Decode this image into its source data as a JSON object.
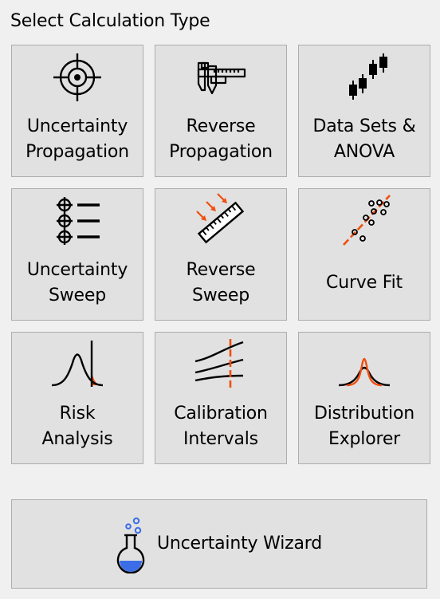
{
  "heading": "Select Calculation Type",
  "colors": {
    "accent": "#f04e0f",
    "flask_liquid": "#3b6ee6",
    "tile_bg": "#e1e1e1",
    "tile_border": "#adadad"
  },
  "tiles": [
    {
      "label": "Uncertainty\nPropagation",
      "icon": "crosshair-icon"
    },
    {
      "label": "Reverse\nPropagation",
      "icon": "caliper-icon"
    },
    {
      "label": "Data Sets &\nANOVA",
      "icon": "candlestick-icon"
    },
    {
      "label": "Uncertainty\nSweep",
      "icon": "sweep-list-icon"
    },
    {
      "label": "Reverse\nSweep",
      "icon": "ruler-icon"
    },
    {
      "label": "Curve Fit",
      "icon": "scatter-fit-icon"
    },
    {
      "label": "Risk\nAnalysis",
      "icon": "bell-curve-risk-icon"
    },
    {
      "label": "Calibration\nIntervals",
      "icon": "calibration-curves-icon"
    },
    {
      "label": "Distribution\nExplorer",
      "icon": "distribution-icon"
    }
  ],
  "wizard": {
    "label": "Uncertainty Wizard",
    "icon": "flask-icon"
  }
}
